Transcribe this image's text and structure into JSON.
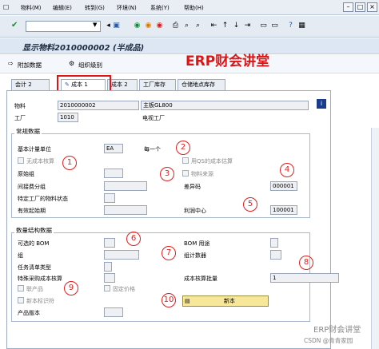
{
  "menu": {
    "items": [
      "物料(M)",
      "编辑(E)",
      "转到(G)",
      "环境(N)",
      "系统(Y)",
      "帮助(H)"
    ]
  },
  "title": "显示物料2010000002 (半成品)",
  "app_toolbar": {
    "additional_data": "附加数据",
    "org_levels": "组织级别"
  },
  "watermark_top": "ERP财会讲堂",
  "tabs": [
    "会计 2",
    "成本 1",
    "成本 2",
    "工厂库存",
    "仓储地点库存"
  ],
  "header": {
    "material_label": "物料",
    "material_value": "2010000002",
    "material_desc": "主板GL800",
    "plant_label": "工厂",
    "plant_value": "1010",
    "plant_desc": "电视工厂"
  },
  "general": {
    "title": "常规数据",
    "base_uom_label": "基本计量单位",
    "base_uom_value": "EA",
    "base_uom_desc": "每一个",
    "no_costing_label": "无成本核算",
    "qs_costing_label": "用QS的成本估算",
    "origin_group_label": "原始组",
    "material_origin_label": "物料来源",
    "overhead_group_label": "间接费分组",
    "variance_key_label": "差异码",
    "variance_key_value": "000001",
    "plant_status_label": "特定工厂的物料状态",
    "valid_from_label": "有效起始期",
    "profit_center_label": "利润中心",
    "profit_center_value": "100001"
  },
  "quantity": {
    "title": "数量结构数据",
    "alt_bom_label": "可选的 BOM",
    "bom_usage_label": "BOM 用途",
    "group_label": "组",
    "group_counter_label": "组计数器",
    "task_list_type_label": "任务清单类型",
    "special_procurement_label": "特殊采购成本核算",
    "lot_size_label": "成本核算批量",
    "lot_size_value": "1",
    "coproduct_label": "联产品",
    "fixed_price_label": "固定价格",
    "with_qs_label": "新本标识符",
    "product_version_label": "产品版本",
    "cost_button_label": "新本"
  },
  "markers": [
    "1",
    "2",
    "3",
    "4",
    "5",
    "6",
    "7",
    "8",
    "9",
    "10"
  ],
  "watermark_bottom": "ERP财会讲堂",
  "watermark_csdn": "CSDN @青青家园"
}
